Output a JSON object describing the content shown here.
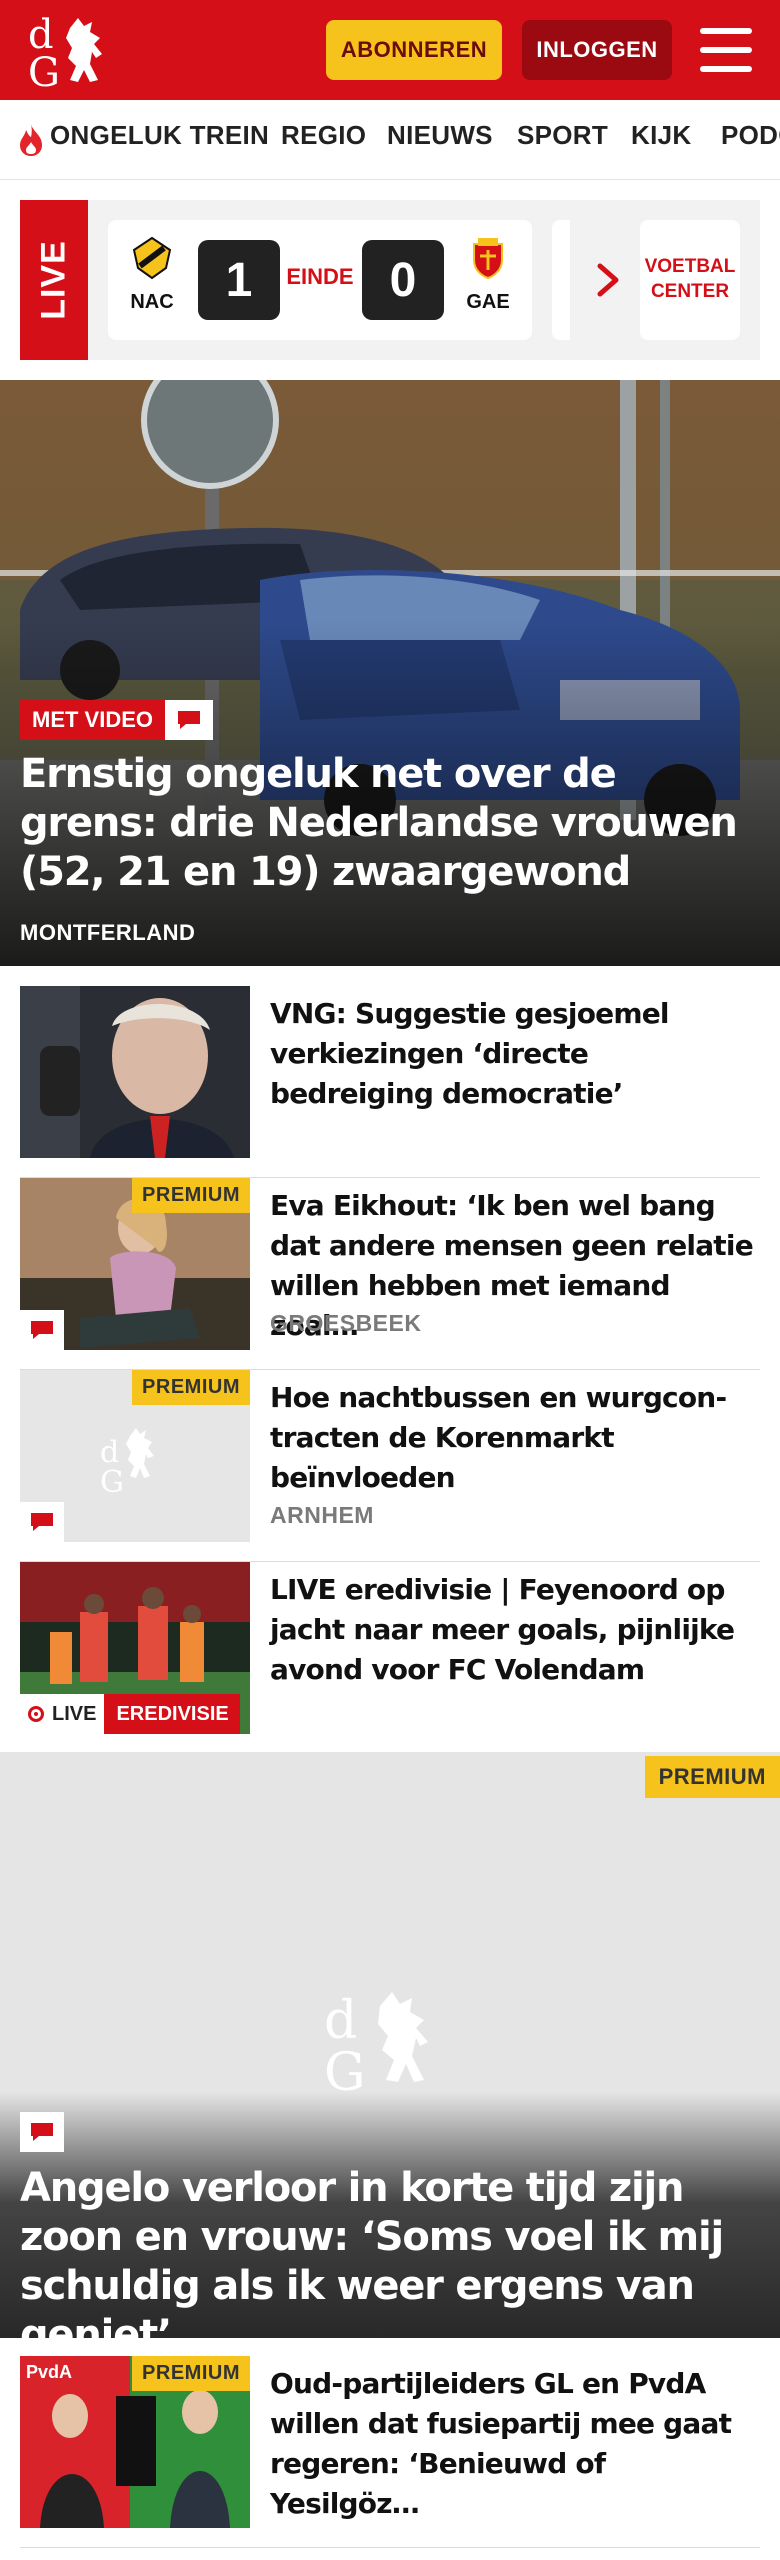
{
  "header": {
    "brand": "dG",
    "subscribe_label": "ABONNEREN",
    "login_label": "INLOGGEN",
    "accent": "#d40f17"
  },
  "nav": {
    "items": [
      {
        "label": "ONGELUK TREIN",
        "icon": "flame-icon"
      },
      {
        "label": "REGIO"
      },
      {
        "label": "NIEUWS"
      },
      {
        "label": "SPORT"
      },
      {
        "label": "KIJK"
      },
      {
        "label": "PODCAST"
      }
    ]
  },
  "live": {
    "label": "LIVE",
    "match": {
      "home": "NAC",
      "away": "GAE",
      "home_score": "1",
      "away_score": "0",
      "status": "EINDE"
    },
    "voetbalcenter_label": "VOETBAL CENTER"
  },
  "hero": {
    "badge": "MET VIDEO",
    "title": "Ernstig ongeluk net over de grens: drie Nederlandse vrouwen (52, 21 en 19) zwaargewond",
    "location": "MONTFERLAND"
  },
  "articles": [
    {
      "title": "VNG: Suggestie gesjoemel verkiezingen ‘directe bedreiging democratie’",
      "location": "",
      "premium": false
    },
    {
      "title": "Eva Eikhout: ‘Ik ben wel bang dat andere mensen geen relatie willen hebben met iemand zoal…",
      "location": "GROESBEEK",
      "premium": true
    },
    {
      "title": "Hoe nachtbussen en wurgcon­tracten de Korenmarkt beïnvloe­den",
      "location": "ARNHEM",
      "premium": true
    },
    {
      "title": "LIVE eredivisie | Feyenoord op jacht naar meer goals, pijnlijke avond voor FC Volendam",
      "location": "",
      "premium": false,
      "live_label": "LIVE",
      "category": "EREDIVISIE"
    }
  ],
  "premium_label": "PREMIUM",
  "feature": {
    "title": "Angelo verloor in korte tijd zijn zoon en vrouw: ‘Soms voel ik mij schuldig als ik weer ergens van geniet’"
  },
  "last_article": {
    "title": "Oud-partijleiders GL en PvdA willen dat fusiepartij mee gaat regeren: ‘Benieuwd of Yesilgöz…"
  }
}
